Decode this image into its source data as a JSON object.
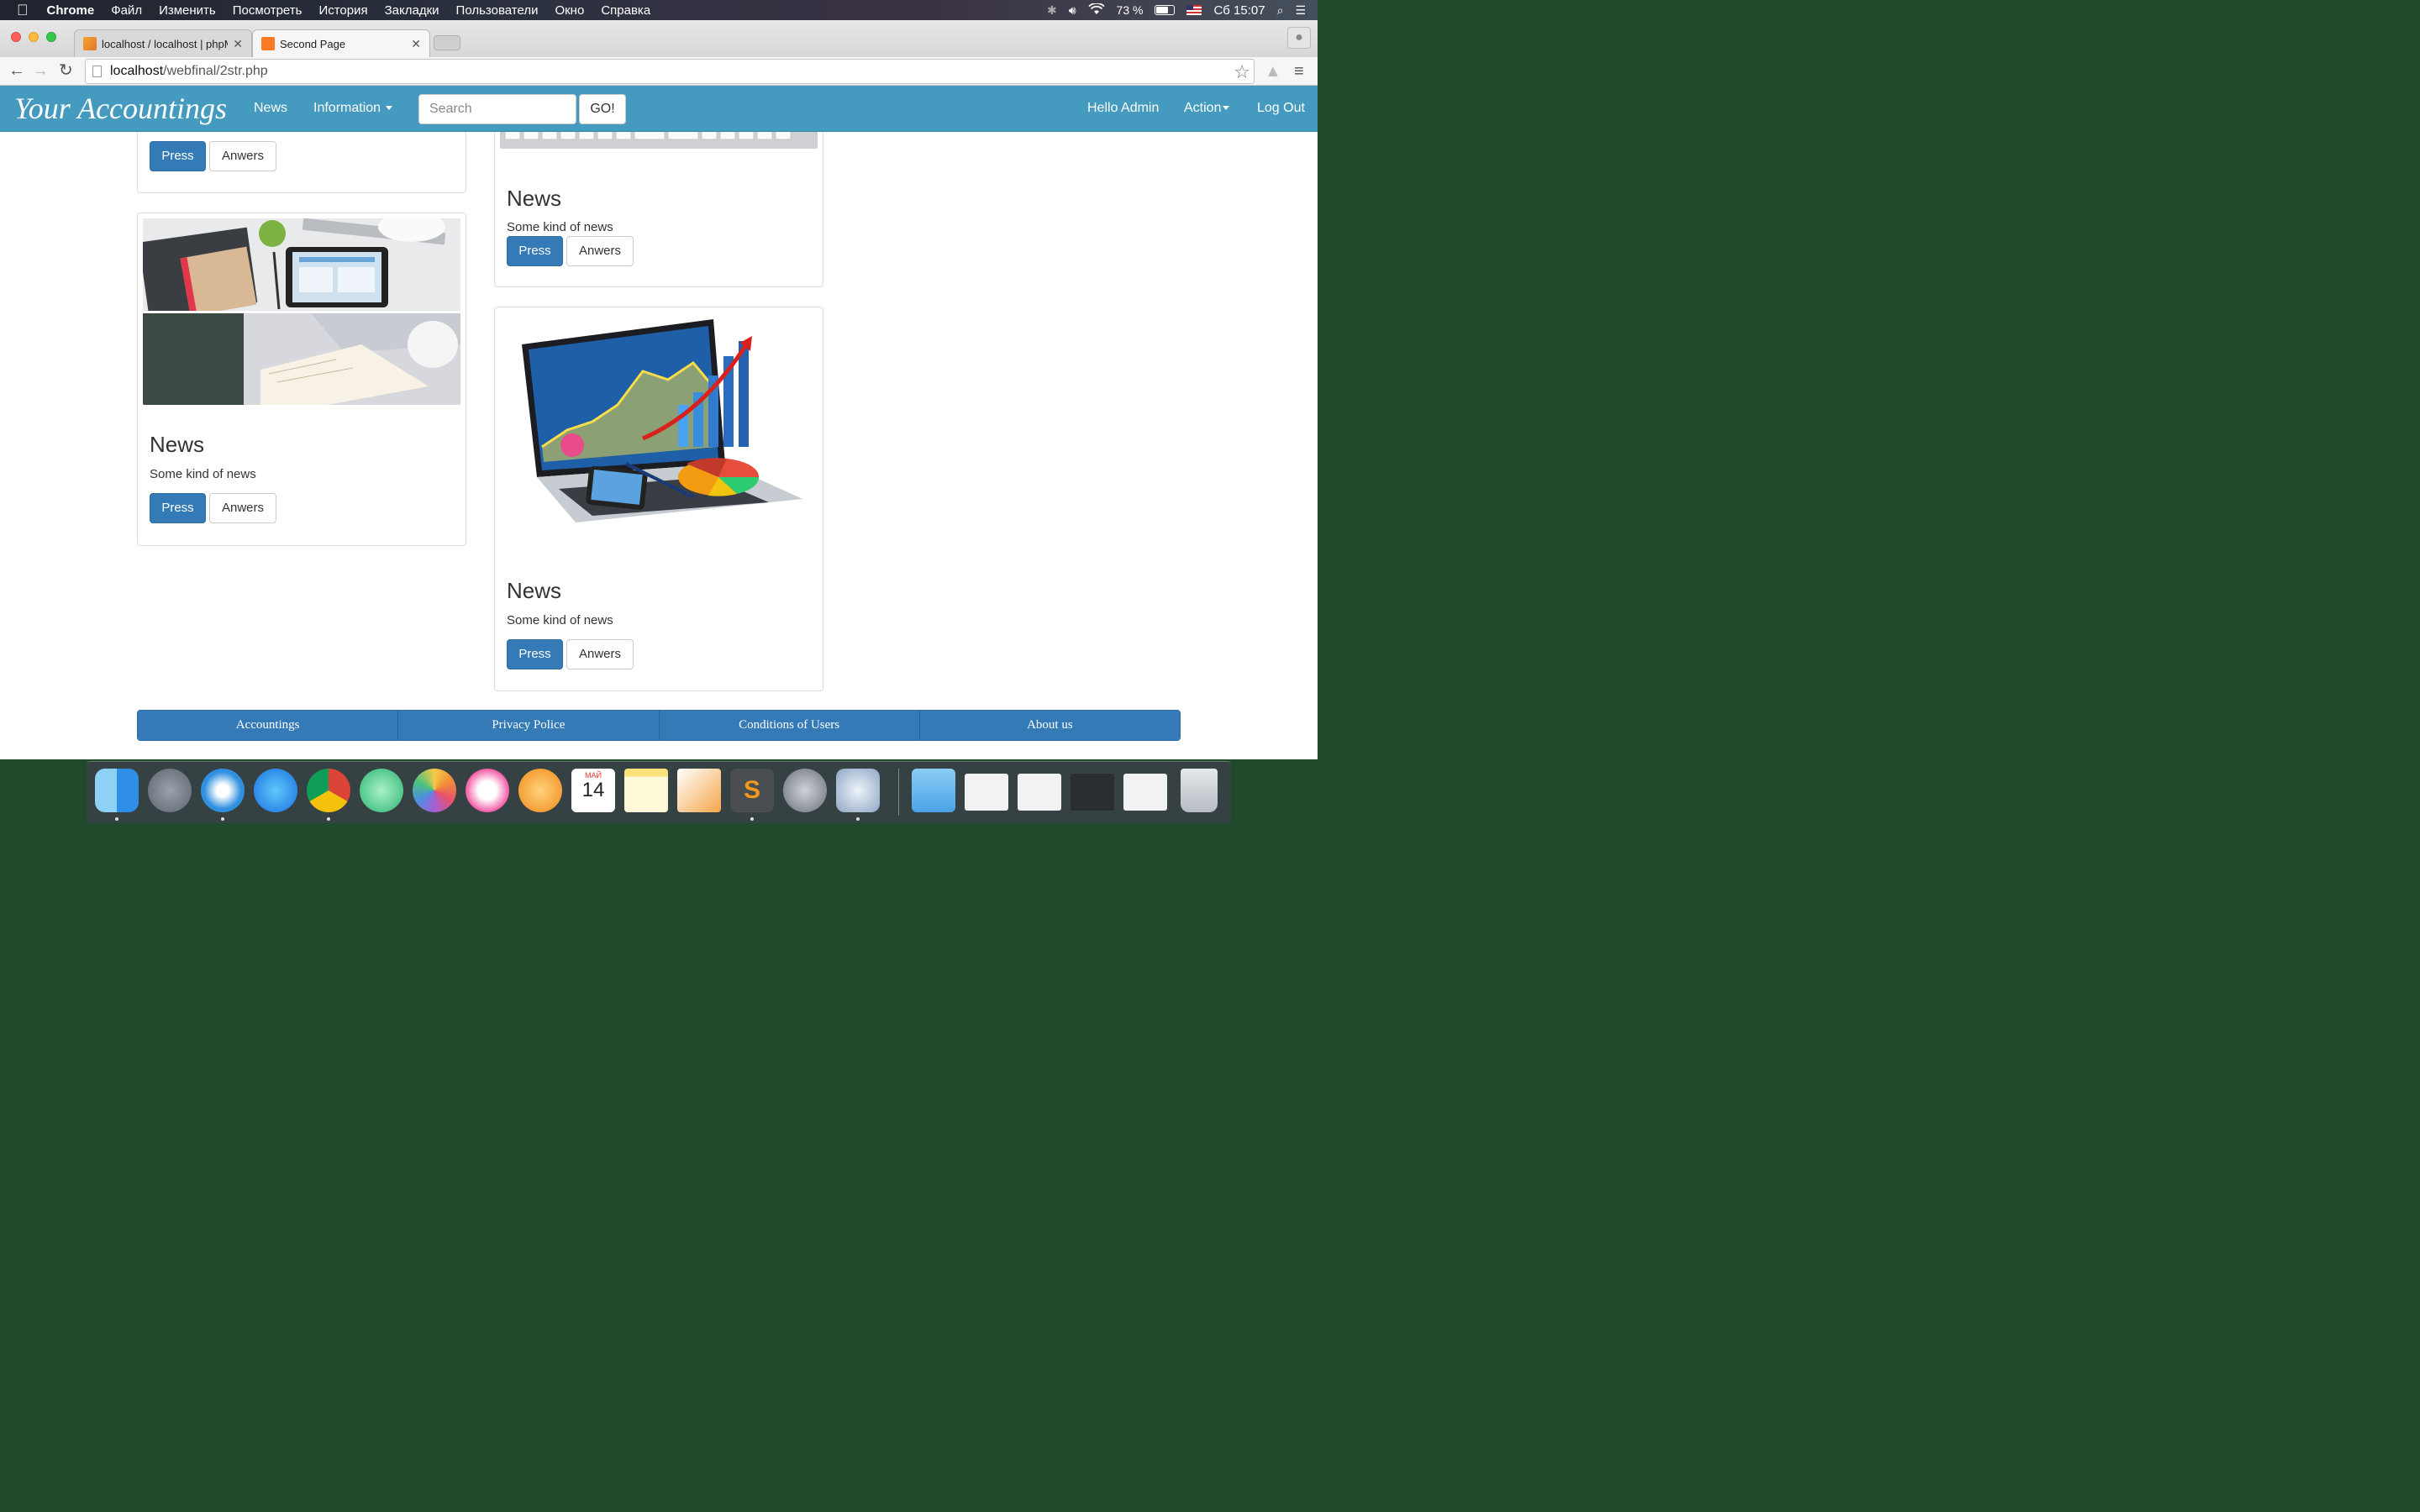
{
  "menubar": {
    "apple": "",
    "app_name": "Chrome",
    "menus": [
      "Файл",
      "Изменить",
      "Посмотреть",
      "История",
      "Закладки",
      "Пользователи",
      "Окно",
      "Справка"
    ],
    "battery": "73 %",
    "battery_level": 0.73,
    "clock": "Сб 15:07"
  },
  "browser": {
    "tabs": [
      {
        "title": "localhost / localhost | phpM",
        "favicon": "phpmyadmin-icon",
        "active": false
      },
      {
        "title": "Second Page",
        "favicon": "xampp-icon",
        "active": true
      }
    ],
    "url_host": "localhost",
    "url_path": "/webfinal/2str.php"
  },
  "navbar": {
    "brand": "Your Accountings",
    "news": "News",
    "information": "Information",
    "search_placeholder": "Search",
    "go": "GO!",
    "hello": "Hello Admin",
    "action": "Action",
    "logout": "Log Out"
  },
  "cards": {
    "top_left": {
      "press": "Press",
      "answers": "Anwers"
    },
    "top_right": {
      "title": "News",
      "text": "Some kind of news",
      "press": "Press",
      "answers": "Anwers"
    },
    "mid_left": {
      "title": "News",
      "text": "Some kind of news",
      "press": "Press",
      "answers": "Anwers",
      "image": "desk-workspace-photo"
    },
    "bottom_right": {
      "title": "News",
      "text": "Some kind of news",
      "press": "Press",
      "answers": "Anwers",
      "image": "laptop-financial-chart-photo"
    }
  },
  "footer": [
    "Accountings",
    "Privacy Police",
    "Conditions of Users",
    "About us"
  ],
  "dock": {
    "calendar_month": "МАЙ",
    "calendar_day": "14",
    "apps": [
      "finder-icon",
      "launchpad-icon",
      "safari-icon",
      "app-store-icon",
      "chrome-icon",
      "atom-icon",
      "photos-icon",
      "itunes-icon",
      "ibooks-icon",
      "calendar-icon",
      "notes-icon",
      "pages-icon",
      "sublime-text-icon",
      "system-preferences-icon",
      "settings-icon",
      "downloads-folder-icon",
      "window-thumbnail-icon",
      "trash-icon"
    ]
  },
  "colors": {
    "navbar": "#449abf",
    "primary": "#337ab7"
  }
}
